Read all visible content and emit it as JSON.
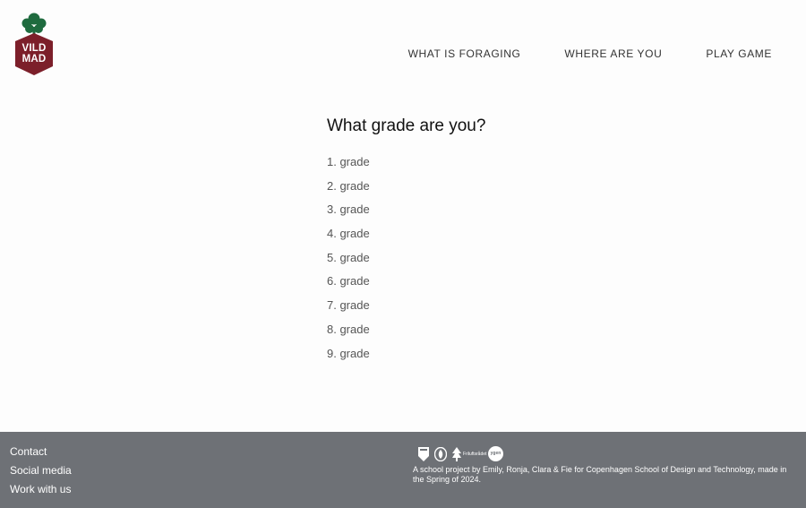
{
  "brand": {
    "logo_line1": "VILD",
    "logo_line2": "MAD",
    "colors": {
      "leaf": "#1f6b3f",
      "badge": "#7c1f2a"
    }
  },
  "nav": {
    "items": [
      {
        "label": "WHAT IS FORAGING"
      },
      {
        "label": "WHERE ARE YOU"
      },
      {
        "label": "PLAY GAME"
      }
    ]
  },
  "main": {
    "question": "What grade are you?",
    "grades": [
      "1. grade",
      "2. grade",
      "3. grade",
      "4. grade",
      "5. grade",
      "6. grade",
      "7. grade",
      "8. grade",
      "9. grade"
    ]
  },
  "footer": {
    "links": [
      {
        "label": "Contact"
      },
      {
        "label": "Social media"
      },
      {
        "label": "Work with us"
      }
    ],
    "partner_icons": [
      "shield-logo-icon",
      "leaf-badge-logo-icon",
      "friluftsraadet-logo-icon",
      "ygen-logo-icon"
    ],
    "friluft_label": "Friluftsrådet",
    "ygen_label": "ygen",
    "credit": "A school project by Emily, Ronja, Clara & Fie for Copenhagen School of Design and Technology, made in the Spring of 2024.",
    "background": "#6e7176"
  }
}
